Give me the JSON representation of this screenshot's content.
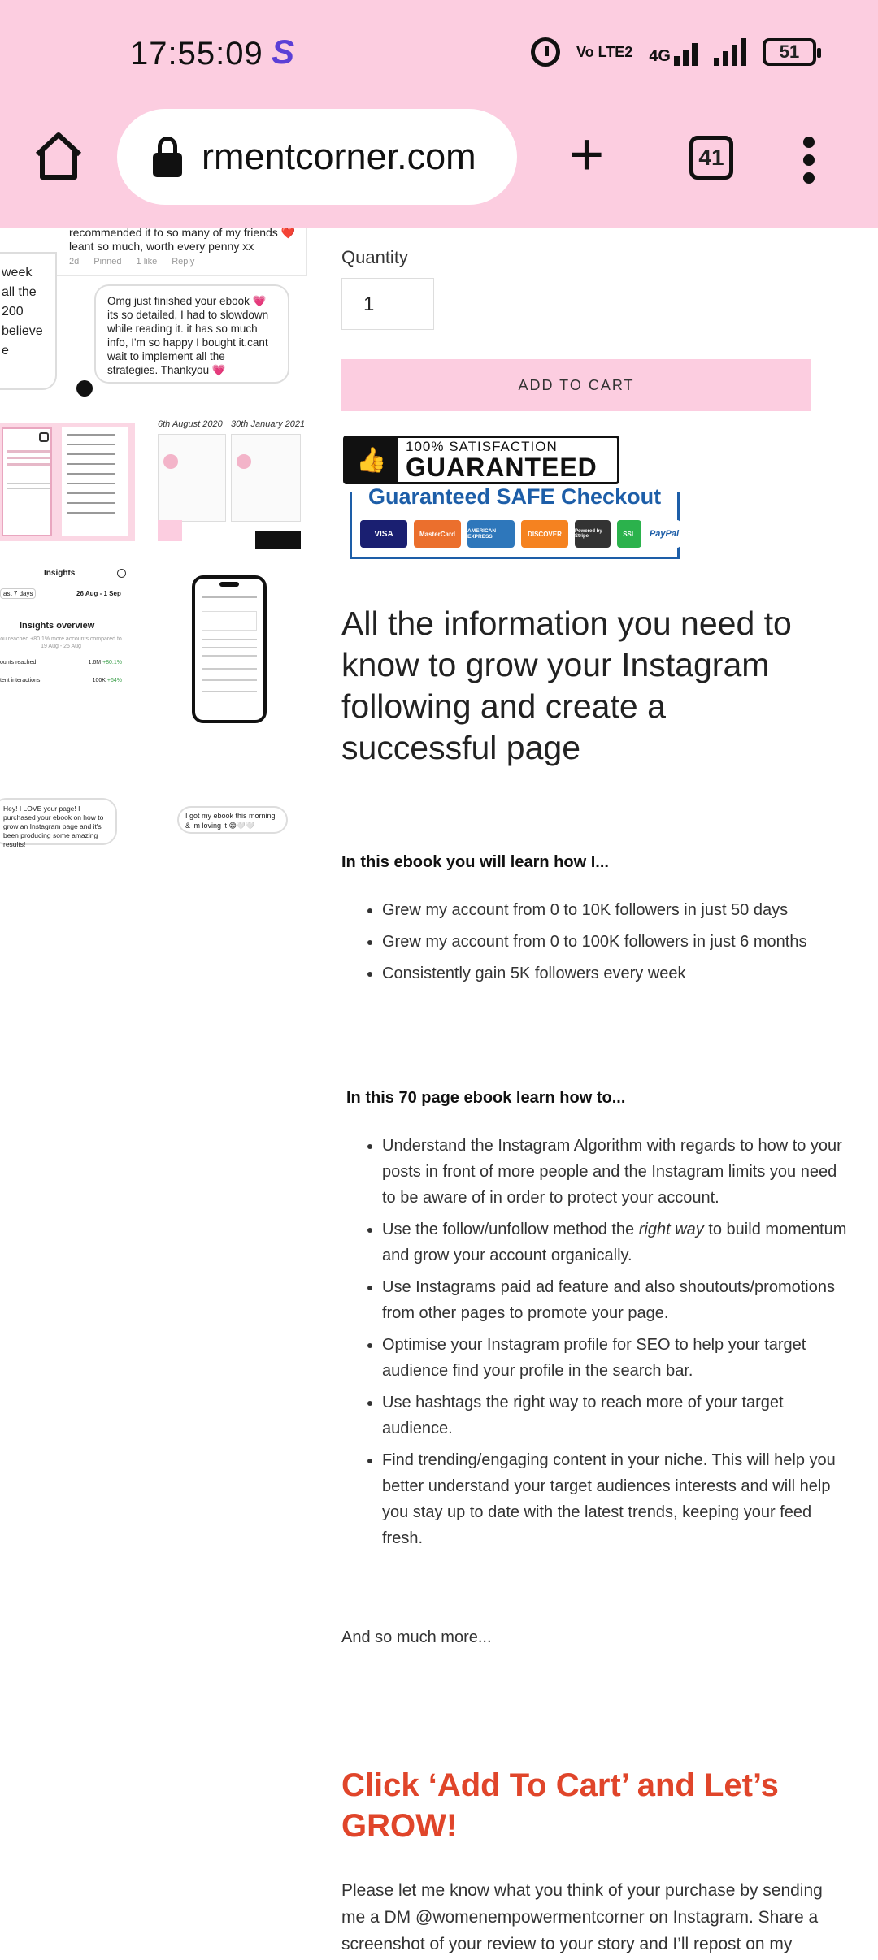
{
  "status_bar": {
    "time": "17:55:09",
    "app_icon": "S",
    "volte": "Vo LTE2",
    "network": "4G",
    "battery": "51"
  },
  "browser": {
    "url": "rmentcorner.com",
    "tab_count": "41",
    "icons": [
      "home-icon",
      "lock-icon",
      "plus-icon",
      "tabs-icon",
      "menu-icon"
    ]
  },
  "gallery": {
    "review_top_line1": "recommended it to so many of my friends ❤️",
    "review_top_line2": "leant so much, worth every penny xx",
    "review_top_meta": [
      "2d",
      "Pinned",
      "1 like",
      "Reply"
    ],
    "review_left_fragment": [
      "week",
      "all the",
      "200",
      "believe",
      "e"
    ],
    "review_bubble": "Omg just finished your ebook 💗 its so detailed, I had to slowdown while reading it. it has so much info, I'm so happy I bought it.cant wait to implement all the strategies. Thankyou 💗",
    "date_left": "6th August 2020",
    "date_right": "30th January 2021",
    "insights_title": "Insights",
    "insights_range_left": "ast 7 days",
    "insights_range_right": "26 Aug - 1 Sep",
    "insights_overview": "Insights overview",
    "insights_sub": "ou reached +80.1% more accounts compared to 19 Aug - 25 Aug",
    "insights_rows": [
      {
        "label": "ounts reached",
        "value": "1.6M",
        "delta": "+80.1%"
      },
      {
        "label": "tent interactions",
        "value": "100K",
        "delta": "+64%"
      }
    ],
    "dm_left": "Hey! I LOVE your page! I purchased your ebook on how to grow an Instagram page and it's been producing some amazing results!",
    "dm_right": "I got my ebook this morning & im loving it 😁🤍🤍"
  },
  "product": {
    "quantity_label": "Quantity",
    "quantity_value": "1",
    "add_to_cart": "ADD TO CART",
    "badge_line1": "100% SATISFACTION",
    "badge_line2": "GUARANTEED",
    "safe_checkout": "Guaranteed SAFE Checkout",
    "cards": [
      "VISA",
      "MasterCard",
      "AMERICAN EXPRESS",
      "DISCOVER",
      "Powered by Stripe",
      "SSL",
      "PayPal"
    ],
    "headline": "All the information you need to know to grow your Instagram following and create a successful page",
    "learn_intro": "In this ebook you will learn how I...",
    "learn_items": [
      "Grew my account from 0 to 10K followers in just 50 days",
      "Grew my account from 0 to 100K followers in just 6 months",
      "Consistently gain 5K followers every week"
    ],
    "howto_intro": "In this 70 page ebook learn how to...",
    "howto_items": [
      "Understand the Instagram Algorithm with regards to how to your posts in front of more people and the Instagram limits you need to be aware of in order to protect your account.",
      "Use the follow/unfollow method the right way to build momentum and grow your account organically.",
      "Use Instagrams paid ad feature and also shoutouts/promotions from other pages to promote your page.",
      "Optimise your Instagram profile for SEO to help your target audience find your profile in the search bar.",
      "Use hashtags the right way to reach more of your target audience.",
      "Find trending/engaging content in your niche. This will help you better understand your target audiences interests and will help you stay up to date with the latest trends, keeping your feed fresh."
    ],
    "howto_item2_pre": "Use the follow/unfollow method the ",
    "howto_item2_em": "right way",
    "howto_item2_post": " to build momentum and grow your account organically.",
    "and_more": "And so much more...",
    "cta": "Click ‘Add To Cart’ and Let’s GROW!",
    "outro": "Please let me know what you think of your purchase by sending me a DM @womenempowermentcorner on Instagram. Share a screenshot of your review to your story and I’ll repost on my"
  },
  "colors": {
    "chrome_bg": "#fccde0",
    "cart_button": "#fccde0",
    "cta_text": "#e0452a",
    "safe_blue": "#1d5ea8",
    "status_s": "#5b3fd6"
  }
}
